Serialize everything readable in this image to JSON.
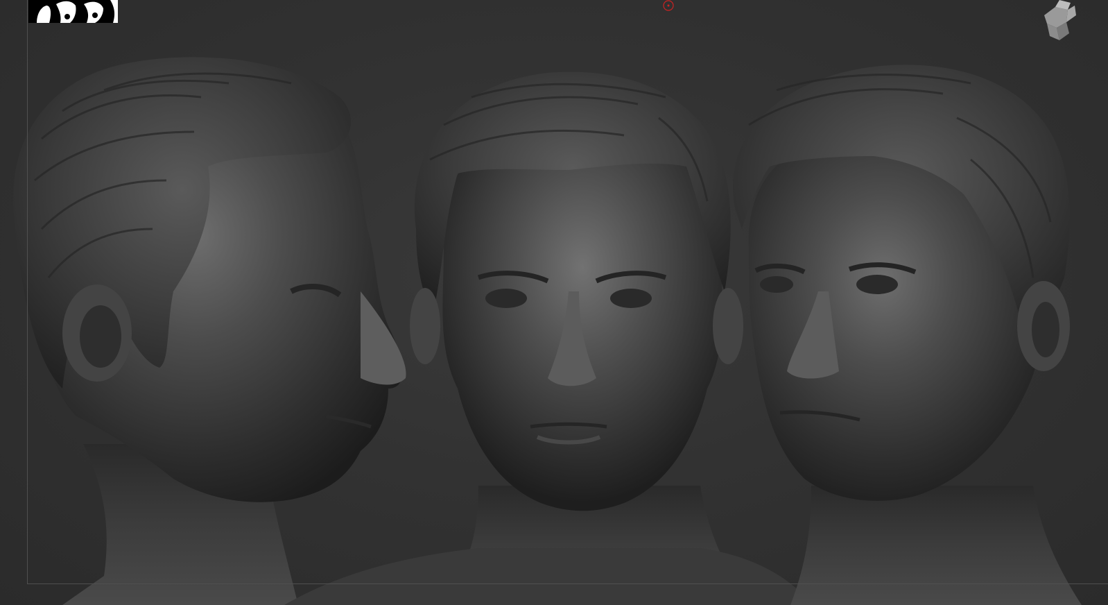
{
  "viewport": {
    "background_color": "#2f2f2f",
    "frame_color": "#505050",
    "views": [
      {
        "view": "side",
        "icon": "sculpted-head-profile"
      },
      {
        "view": "front",
        "icon": "sculpted-head-front"
      },
      {
        "view": "three-quarter",
        "icon": "sculpted-head-three-quarter"
      }
    ]
  },
  "thumbnail": {
    "icon": "model-thumbnail"
  },
  "center_marker": {
    "icon": "pivot-marker",
    "color": "#cc2222"
  },
  "nav_cube": {
    "icon": "navigation-head-gizmo"
  }
}
